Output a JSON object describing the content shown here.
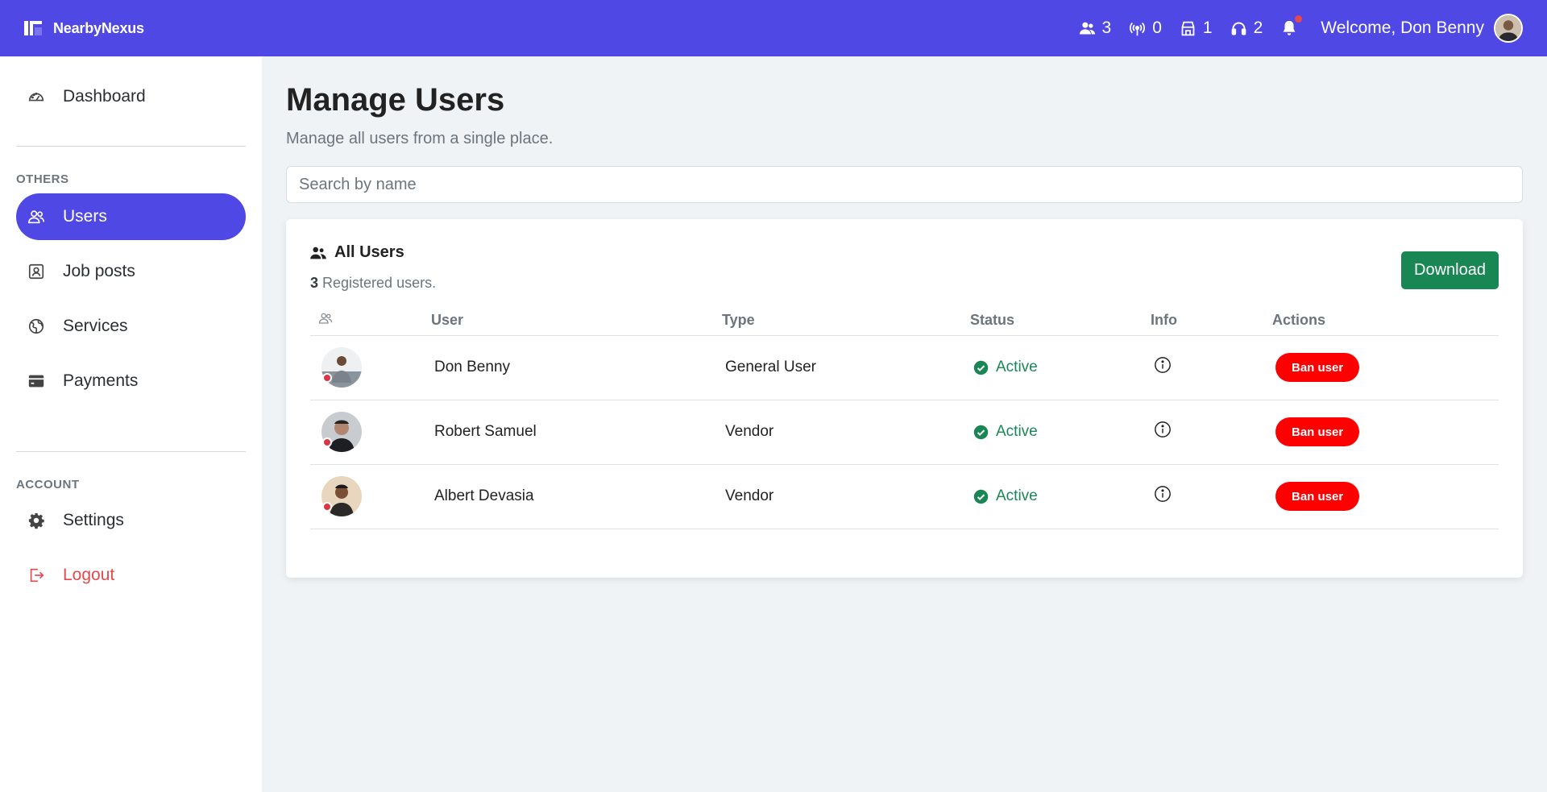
{
  "app": {
    "brand": "NearbyNexus"
  },
  "topbar": {
    "users_count": "3",
    "broadcast_count": "0",
    "vendors_count": "1",
    "support_count": "2",
    "welcome": "Welcome, Don Benny"
  },
  "sidebar": {
    "dashboard": "Dashboard",
    "others_label": "OTHERS",
    "items": [
      "Users",
      "Job posts",
      "Services",
      "Payments"
    ],
    "account_label": "ACCOUNT",
    "settings": "Settings",
    "logout": "Logout"
  },
  "main": {
    "title": "Manage Users",
    "subtitle": "Manage all users from a single place.",
    "search_placeholder": "Search by name",
    "card_title": "All Users",
    "count": "3",
    "count_suffix": " Registered users.",
    "download": "Download",
    "columns": [
      "User",
      "Type",
      "Status",
      "Info",
      "Actions"
    ],
    "rows": [
      {
        "name": "Don Benny",
        "type": "General User",
        "status": "Active",
        "action": "Ban user"
      },
      {
        "name": "Robert Samuel",
        "type": "Vendor",
        "status": "Active",
        "action": "Ban user"
      },
      {
        "name": "Albert Devasia",
        "type": "Vendor",
        "status": "Active",
        "action": "Ban user"
      }
    ]
  },
  "colors": {
    "primary": "#5048e5",
    "success": "#198754",
    "danger": "#ff0000"
  }
}
